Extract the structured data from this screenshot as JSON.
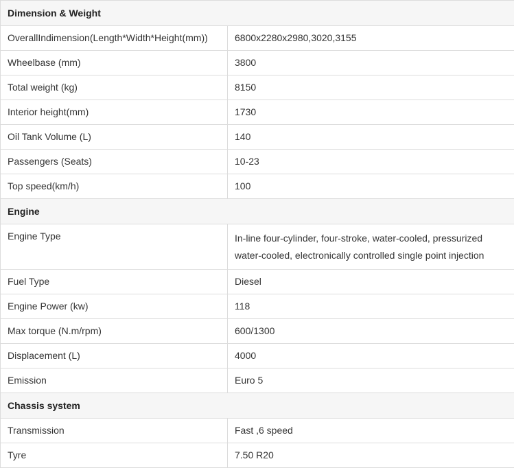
{
  "sections": [
    {
      "title": "Dimension & Weight",
      "rows": [
        {
          "label": "OverallIndimension(Length*Width*Height(mm))",
          "value": "6800x2280x2980,3020,3155"
        },
        {
          "label": "Wheelbase (mm)",
          "value": "3800"
        },
        {
          "label": "Total weight (kg)",
          "value": "8150"
        },
        {
          "label": "Interior height(mm)",
          "value": "1730"
        },
        {
          "label": "Oil Tank Volume (L)",
          "value": "140"
        },
        {
          "label": "Passengers (Seats)",
          "value": "10-23"
        },
        {
          "label": "Top speed(km/h)",
          "value": "100"
        }
      ]
    },
    {
      "title": "Engine",
      "rows": [
        {
          "label": "Engine Type",
          "value": "In-line four-cylinder, four-stroke, water-cooled, pressurized water-cooled, electronically controlled single point injection"
        },
        {
          "label": "Fuel Type",
          "value": "Diesel"
        },
        {
          "label": "Engine Power (kw)",
          "value": "118"
        },
        {
          "label": "Max torque (N.m/rpm)",
          "value": "600/1300"
        },
        {
          "label": "Displacement (L)",
          "value": "4000"
        },
        {
          "label": "Emission",
          "value": "Euro 5"
        }
      ]
    },
    {
      "title": "Chassis system",
      "rows": [
        {
          "label": "Transmission",
          "value": "Fast ,6 speed"
        },
        {
          "label": "Tyre",
          "value": "7.50 R20"
        }
      ]
    }
  ]
}
